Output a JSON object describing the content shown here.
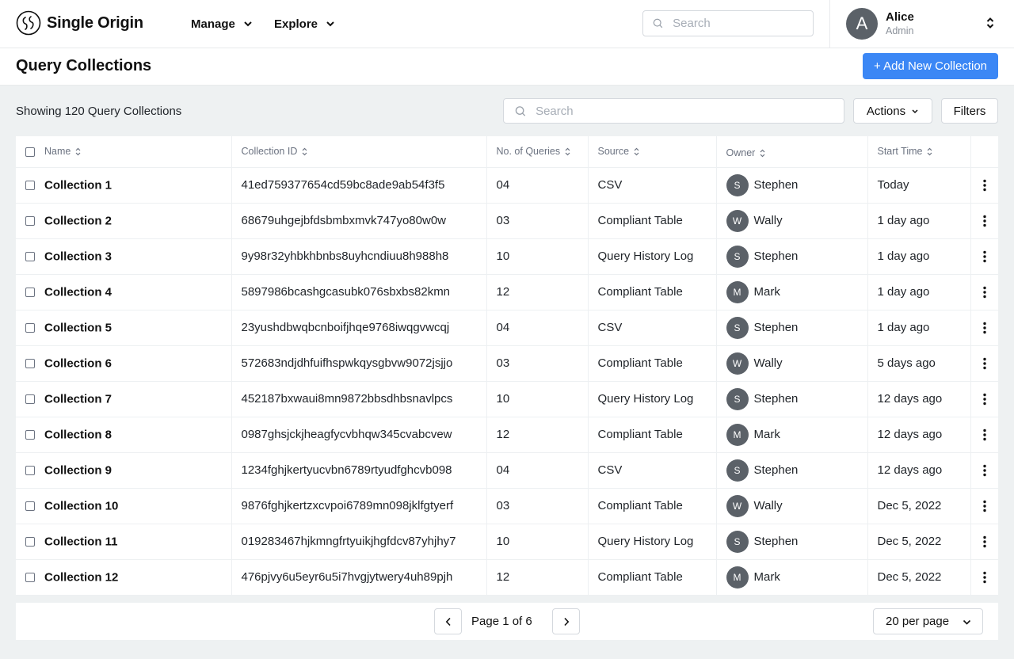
{
  "app": {
    "brand": "Single Origin",
    "nav": [
      {
        "label": "Manage",
        "icon": "chevron-down-icon"
      },
      {
        "label": "Explore",
        "icon": "chevron-down-icon"
      }
    ],
    "search_placeholder": "Search",
    "user": {
      "initial": "A",
      "name": "Alice",
      "role": "Admin"
    }
  },
  "page": {
    "title": "Query Collections",
    "add_button": "+ Add New Collection",
    "showing": "Showing 120 Query Collections",
    "search_placeholder": "Search",
    "actions_label": "Actions",
    "filters_label": "Filters"
  },
  "table": {
    "columns": [
      "Name",
      "Collection ID",
      "No. of Queries",
      "Source",
      "Owner",
      "Start Time"
    ],
    "rows": [
      {
        "name": "Collection 1",
        "id": "41ed759377654cd59bc8ade9ab54f3f5",
        "queries": "04",
        "source": "CSV",
        "owner": "Stephen",
        "owner_initial": "S",
        "start": "Today"
      },
      {
        "name": "Collection 2",
        "id": "68679uhgejbfdsbmbxmvk747yo80w0w",
        "queries": "03",
        "source": "Compliant Table",
        "owner": "Wally",
        "owner_initial": "W",
        "start": "1 day ago"
      },
      {
        "name": "Collection 3",
        "id": "9y98r32yhbkhbnbs8uyhcndiuu8h988h8",
        "queries": "10",
        "source": "Query History Log",
        "owner": "Stephen",
        "owner_initial": "S",
        "start": "1 day ago"
      },
      {
        "name": "Collection 4",
        "id": "5897986bcashgcasubk076sbxbs82kmn",
        "queries": "12",
        "source": "Compliant Table",
        "owner": "Mark",
        "owner_initial": "M",
        "start": "1 day ago"
      },
      {
        "name": "Collection 5",
        "id": "23yushdbwqbcnboifjhqe9768iwqgvwcqj",
        "queries": "04",
        "source": "CSV",
        "owner": "Stephen",
        "owner_initial": "S",
        "start": "1 day ago"
      },
      {
        "name": "Collection 6",
        "id": "572683ndjdhfuifhspwkqysgbvw9072jsjjo",
        "queries": "03",
        "source": "Compliant Table",
        "owner": "Wally",
        "owner_initial": "W",
        "start": "5 days ago"
      },
      {
        "name": "Collection 7",
        "id": "452187bxwaui8mn9872bbsdhbsnavlpcs",
        "queries": "10",
        "source": "Query History Log",
        "owner": "Stephen",
        "owner_initial": "S",
        "start": "12 days ago"
      },
      {
        "name": "Collection 8",
        "id": "0987ghsjckjheagfycvbhqw345cvabcvew",
        "queries": "12",
        "source": "Compliant Table",
        "owner": "Mark",
        "owner_initial": "M",
        "start": "12 days ago"
      },
      {
        "name": "Collection 9",
        "id": "1234fghjkertyucvbn6789rtyudfghcvb098",
        "queries": "04",
        "source": "CSV",
        "owner": "Stephen",
        "owner_initial": "S",
        "start": "12 days ago"
      },
      {
        "name": "Collection 10",
        "id": "9876fghjkertzxcvpoi6789mn098jklfgtyerf",
        "queries": "03",
        "source": "Compliant Table",
        "owner": "Wally",
        "owner_initial": "W",
        "start": "Dec 5, 2022"
      },
      {
        "name": "Collection 11",
        "id": "019283467hjkmngfrtyuikjhgfdcv87yhjhy7",
        "queries": "10",
        "source": "Query History Log",
        "owner": "Stephen",
        "owner_initial": "S",
        "start": "Dec 5, 2022"
      },
      {
        "name": "Collection 12",
        "id": "476pjvy6u5eyr6u5i7hvgjytwery4uh89pjh",
        "queries": "12",
        "source": "Compliant Table",
        "owner": "Mark",
        "owner_initial": "M",
        "start": "Dec 5, 2022"
      }
    ]
  },
  "pagination": {
    "page_label": "Page 1 of 6",
    "per_page": "20 per page"
  },
  "colors": {
    "accent": "#3b87f5",
    "avatar": "#5b6168",
    "background": "#eef1f2"
  }
}
